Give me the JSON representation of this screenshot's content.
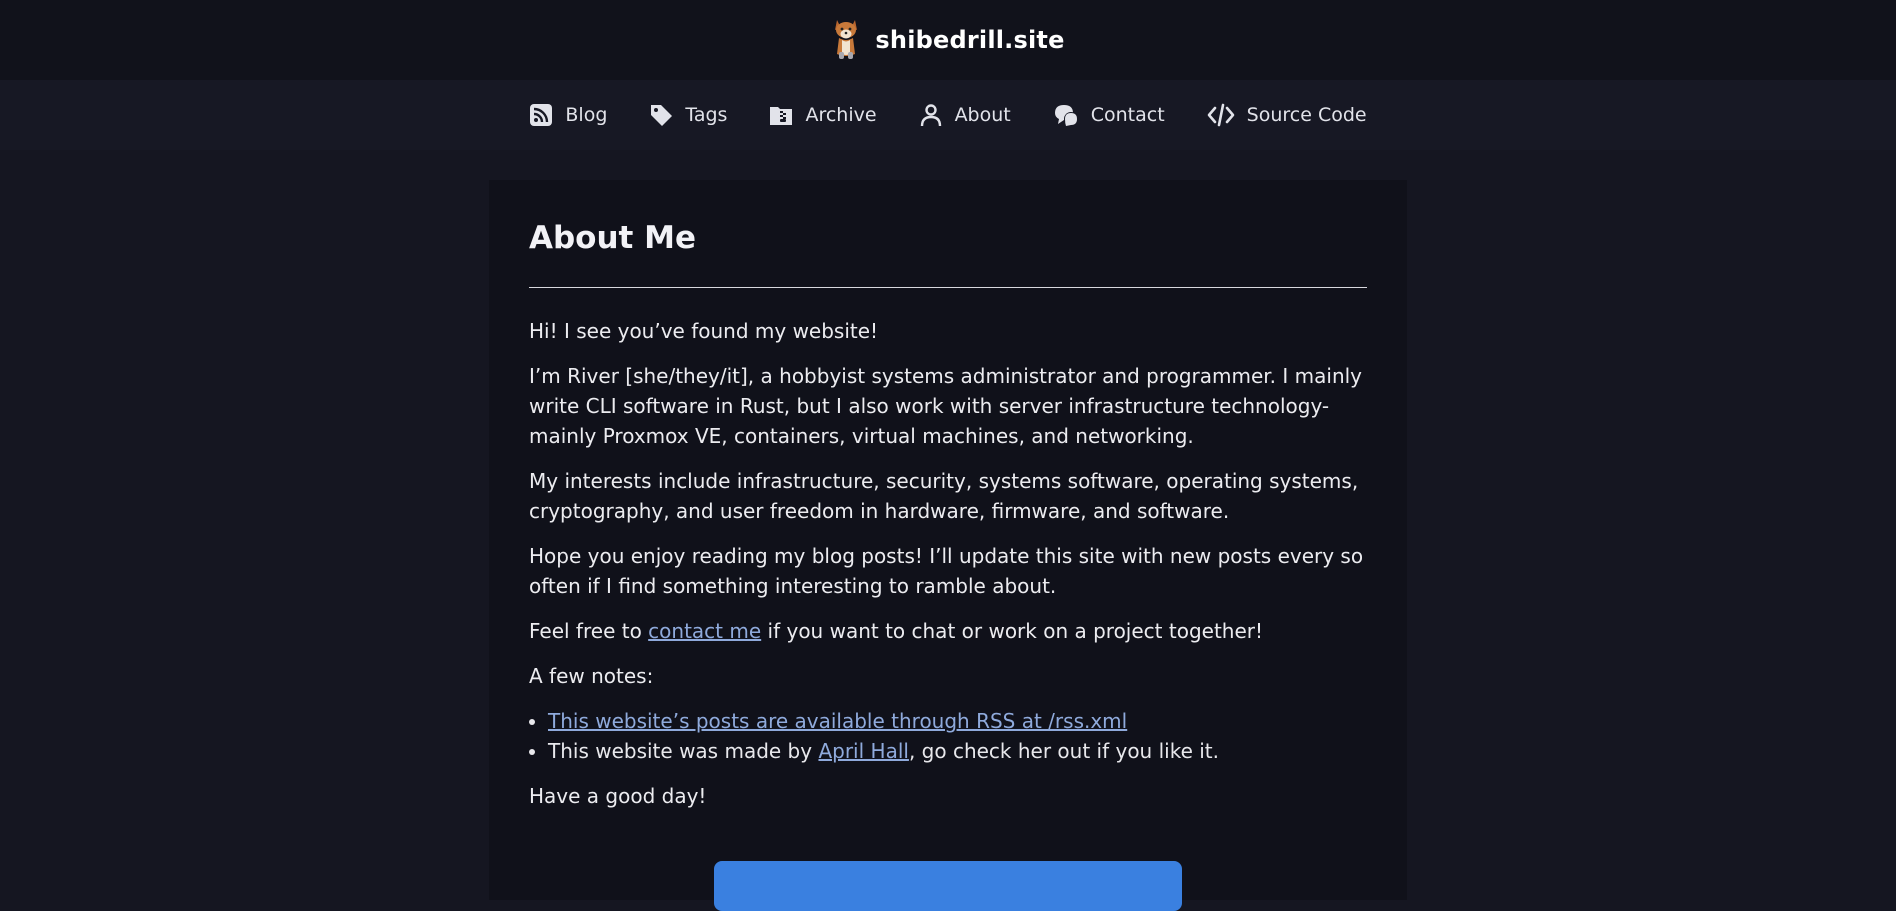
{
  "site": {
    "title": "shibedrill.site",
    "logo_icon": "shiba-dog-logo-icon"
  },
  "nav": {
    "items": [
      {
        "label": "Blog",
        "icon": "rss-icon"
      },
      {
        "label": "Tags",
        "icon": "tag-icon"
      },
      {
        "label": "Archive",
        "icon": "archive-file-icon"
      },
      {
        "label": "About",
        "icon": "user-icon"
      },
      {
        "label": "Contact",
        "icon": "chat-bubbles-icon"
      },
      {
        "label": "Source Code",
        "icon": "code-icon"
      }
    ]
  },
  "page": {
    "heading": "About Me",
    "p1": "Hi! I see you’ve found my website!",
    "p2": "I’m River [she/they/it], a hobbyist systems administrator and programmer. I mainly write CLI software in Rust, but I also work with server infrastructure technology- mainly Proxmox VE, containers, virtual machines, and networking.",
    "p3": "My interests include infrastructure, security, systems software, operating systems, cryptography, and user freedom in hardware, firmware, and software.",
    "p4": "Hope you enjoy reading my blog posts! I’ll update this site with new posts every so often if I find something interesting to ramble about.",
    "p5_before": "Feel free to ",
    "p5_link": "contact me",
    "p5_after": " if you want to chat or work on a project together!",
    "notes_label": "A few notes:",
    "note1_link": "This website’s posts are available through RSS at /rss.xml",
    "note2_before": "This website was made by ",
    "note2_link": "April Hall",
    "note2_after": ", go check her out if you like it.",
    "closing": "Have a good day!"
  },
  "colors": {
    "background": "#151621",
    "card": "#10111a",
    "link": "#8faadc",
    "button": "#3a80e0"
  }
}
